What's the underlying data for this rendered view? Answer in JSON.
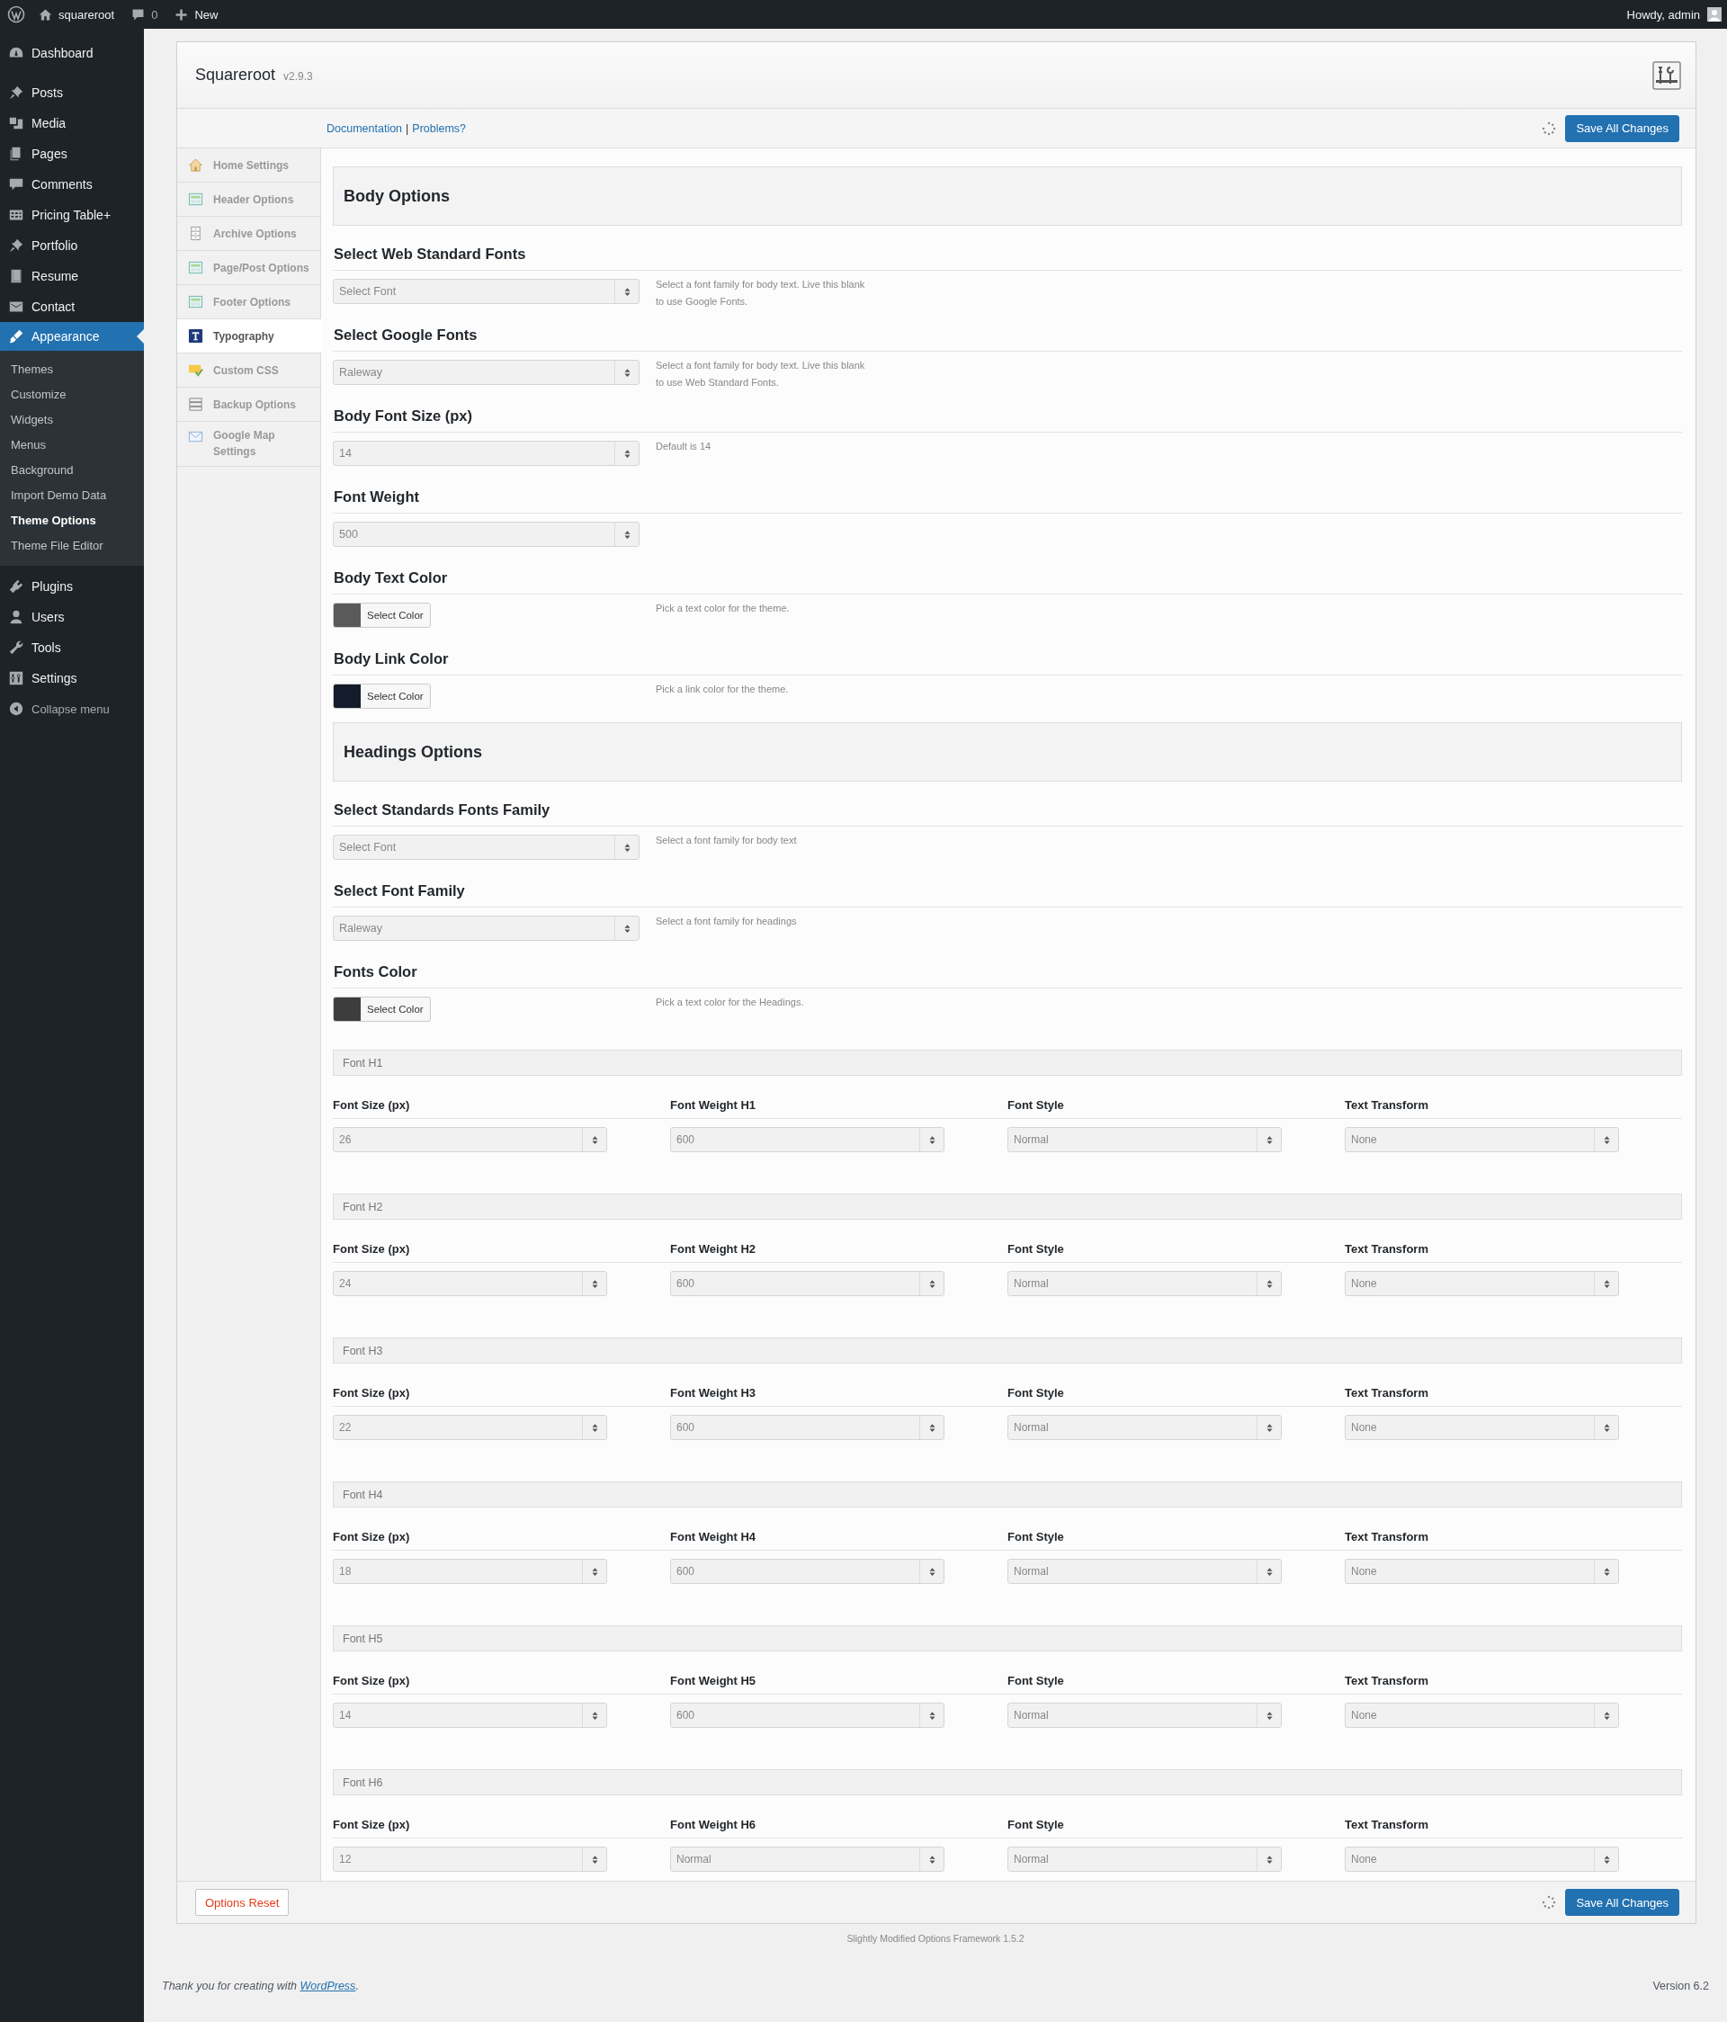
{
  "admin_bar": {
    "site_name": "squareroot",
    "comments_count": "0",
    "new_label": "New",
    "greeting": "Howdy, admin"
  },
  "sidebar": {
    "items": [
      {
        "label": "Dashboard",
        "kind": "dashboard",
        "selected": false
      },
      {
        "label": "Posts",
        "kind": "pin",
        "selected": false
      },
      {
        "label": "Media",
        "kind": "media",
        "selected": false
      },
      {
        "label": "Pages",
        "kind": "pages",
        "selected": false
      },
      {
        "label": "Comments",
        "kind": "comment",
        "selected": false
      },
      {
        "label": "Pricing Table+",
        "kind": "table",
        "selected": false
      },
      {
        "label": "Portfolio",
        "kind": "pin",
        "selected": false
      },
      {
        "label": "Resume",
        "kind": "book",
        "selected": false
      },
      {
        "label": "Contact",
        "kind": "mail",
        "selected": false
      },
      {
        "label": "Appearance",
        "kind": "brush",
        "selected": true,
        "children": [
          {
            "label": "Themes",
            "selected": false
          },
          {
            "label": "Customize",
            "selected": false
          },
          {
            "label": "Widgets",
            "selected": false
          },
          {
            "label": "Menus",
            "selected": false
          },
          {
            "label": "Background",
            "selected": false
          },
          {
            "label": "Import Demo Data",
            "selected": false
          },
          {
            "label": "Theme Options",
            "selected": true
          },
          {
            "label": "Theme File Editor",
            "selected": false
          }
        ]
      },
      {
        "label": "Plugins",
        "kind": "plug",
        "selected": false
      },
      {
        "label": "Users",
        "kind": "user",
        "selected": false
      },
      {
        "label": "Tools",
        "kind": "wrench",
        "selected": false
      },
      {
        "label": "Settings",
        "kind": "sliders",
        "selected": false
      }
    ],
    "collapse_label": "Collapse menu"
  },
  "panel": {
    "title": "Squareroot",
    "version": "v2.9.3",
    "links": [
      "Documentation",
      "Problems?"
    ],
    "link_separator": "|",
    "save_label": "Save All Changes",
    "tabs": [
      {
        "label": "Home Settings",
        "kind": "home",
        "selected": false
      },
      {
        "label": "Header Options",
        "kind": "layout",
        "selected": false
      },
      {
        "label": "Archive Options",
        "kind": "cabinet",
        "selected": false
      },
      {
        "label": "Page/Post Options",
        "kind": "layout",
        "selected": false
      },
      {
        "label": "Footer Options",
        "kind": "layout",
        "selected": false
      },
      {
        "label": "Typography",
        "kind": "type",
        "selected": true
      },
      {
        "label": "Custom CSS",
        "kind": "css",
        "selected": false
      },
      {
        "label": "Backup Options",
        "kind": "stack",
        "selected": false
      },
      {
        "label": "Google Map Settings",
        "kind": "envelope",
        "selected": false
      }
    ],
    "sections": [
      {
        "kind": "heading",
        "title": "Body Options"
      },
      {
        "kind": "select",
        "label": "Select Web Standard Fonts",
        "value": "Select Font",
        "help": "Select a font family for body text. Live this blank to use Google Fonts."
      },
      {
        "kind": "select",
        "label": "Select Google Fonts",
        "value": "Raleway",
        "help": "Select a font family for body text. Live this blank to use Web Standard Fonts."
      },
      {
        "kind": "select",
        "label": "Body Font Size (px)",
        "value": "14",
        "help": "Default is 14"
      },
      {
        "kind": "select",
        "label": "Font Weight",
        "value": "500"
      },
      {
        "kind": "color",
        "label": "Body Text Color",
        "button": "Select Color",
        "color": "#5a5a5a",
        "help": "Pick a text color for the theme."
      },
      {
        "kind": "color",
        "label": "Body Link Color",
        "button": "Select Color",
        "color": "#141c2b",
        "help": "Pick a link color for the theme."
      },
      {
        "kind": "heading",
        "title": "Headings Options"
      },
      {
        "kind": "select",
        "label": "Select Standards Fonts Family",
        "value": "Select Font",
        "help": "Select a font family for body text"
      },
      {
        "kind": "select",
        "label": "Select Font Family",
        "value": "Raleway",
        "help": "Select a font family for headings"
      },
      {
        "kind": "color",
        "label": "Fonts Color",
        "button": "Select Color",
        "color": "#3d3d3d",
        "help": "Pick a text color for the Headings."
      },
      {
        "kind": "font_group",
        "title": "Font H1",
        "fields": [
          {
            "label": "Font Size (px)",
            "value": "26"
          },
          {
            "label": "Font Weight H1",
            "value": "600"
          },
          {
            "label": "Font Style",
            "value": "Normal"
          },
          {
            "label": "Text Transform",
            "value": "None"
          }
        ]
      },
      {
        "kind": "font_group",
        "title": "Font H2",
        "fields": [
          {
            "label": "Font Size (px)",
            "value": "24"
          },
          {
            "label": "Font Weight H2",
            "value": "600"
          },
          {
            "label": "Font Style",
            "value": "Normal"
          },
          {
            "label": "Text Transform",
            "value": "None"
          }
        ]
      },
      {
        "kind": "font_group",
        "title": "Font H3",
        "fields": [
          {
            "label": "Font Size (px)",
            "value": "22"
          },
          {
            "label": "Font Weight H3",
            "value": "600"
          },
          {
            "label": "Font Style",
            "value": "Normal"
          },
          {
            "label": "Text Transform",
            "value": "None"
          }
        ]
      },
      {
        "kind": "font_group",
        "title": "Font H4",
        "fields": [
          {
            "label": "Font Size (px)",
            "value": "18"
          },
          {
            "label": "Font Weight H4",
            "value": "600"
          },
          {
            "label": "Font Style",
            "value": "Normal"
          },
          {
            "label": "Text Transform",
            "value": "None"
          }
        ]
      },
      {
        "kind": "font_group",
        "title": "Font H5",
        "fields": [
          {
            "label": "Font Size (px)",
            "value": "14"
          },
          {
            "label": "Font Weight H5",
            "value": "600"
          },
          {
            "label": "Font Style",
            "value": "Normal"
          },
          {
            "label": "Text Transform",
            "value": "None"
          }
        ]
      },
      {
        "kind": "font_group",
        "title": "Font H6",
        "fields": [
          {
            "label": "Font Size (px)",
            "value": "12"
          },
          {
            "label": "Font Weight H6",
            "value": "Normal"
          },
          {
            "label": "Font Style",
            "value": "Normal"
          },
          {
            "label": "Text Transform",
            "value": "None"
          }
        ]
      }
    ],
    "reset_label": "Options Reset",
    "bottom_save_label": "Save All Changes"
  },
  "framework_note": "Slightly Modified Options Framework 1.5.2",
  "footer": {
    "thanks": "Thank you for creating with",
    "link": "WordPress",
    "after_link": ".",
    "version": "Version 6.2"
  }
}
